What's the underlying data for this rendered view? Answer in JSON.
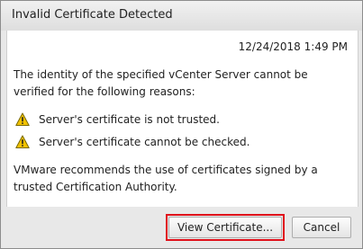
{
  "dialog": {
    "title": "Invalid Certificate Detected",
    "timestamp": "12/24/2018 1:49 PM",
    "message": "The identity of the specified vCenter Server cannot be verified for the following reasons:",
    "reasons": [
      {
        "icon": "warning-icon",
        "text": "Server's certificate is not trusted."
      },
      {
        "icon": "warning-icon",
        "text": "Server's certificate cannot be checked."
      }
    ],
    "recommendation": "VMware recommends the use of certificates signed by a trusted Certification Authority.",
    "buttons": {
      "view_certificate": "View Certificate...",
      "cancel": "Cancel"
    }
  },
  "colors": {
    "highlight": "#e0101b",
    "warning_fill": "#f2c200",
    "dialog_bg": "#e8e8e8",
    "content_bg": "#ffffff"
  }
}
